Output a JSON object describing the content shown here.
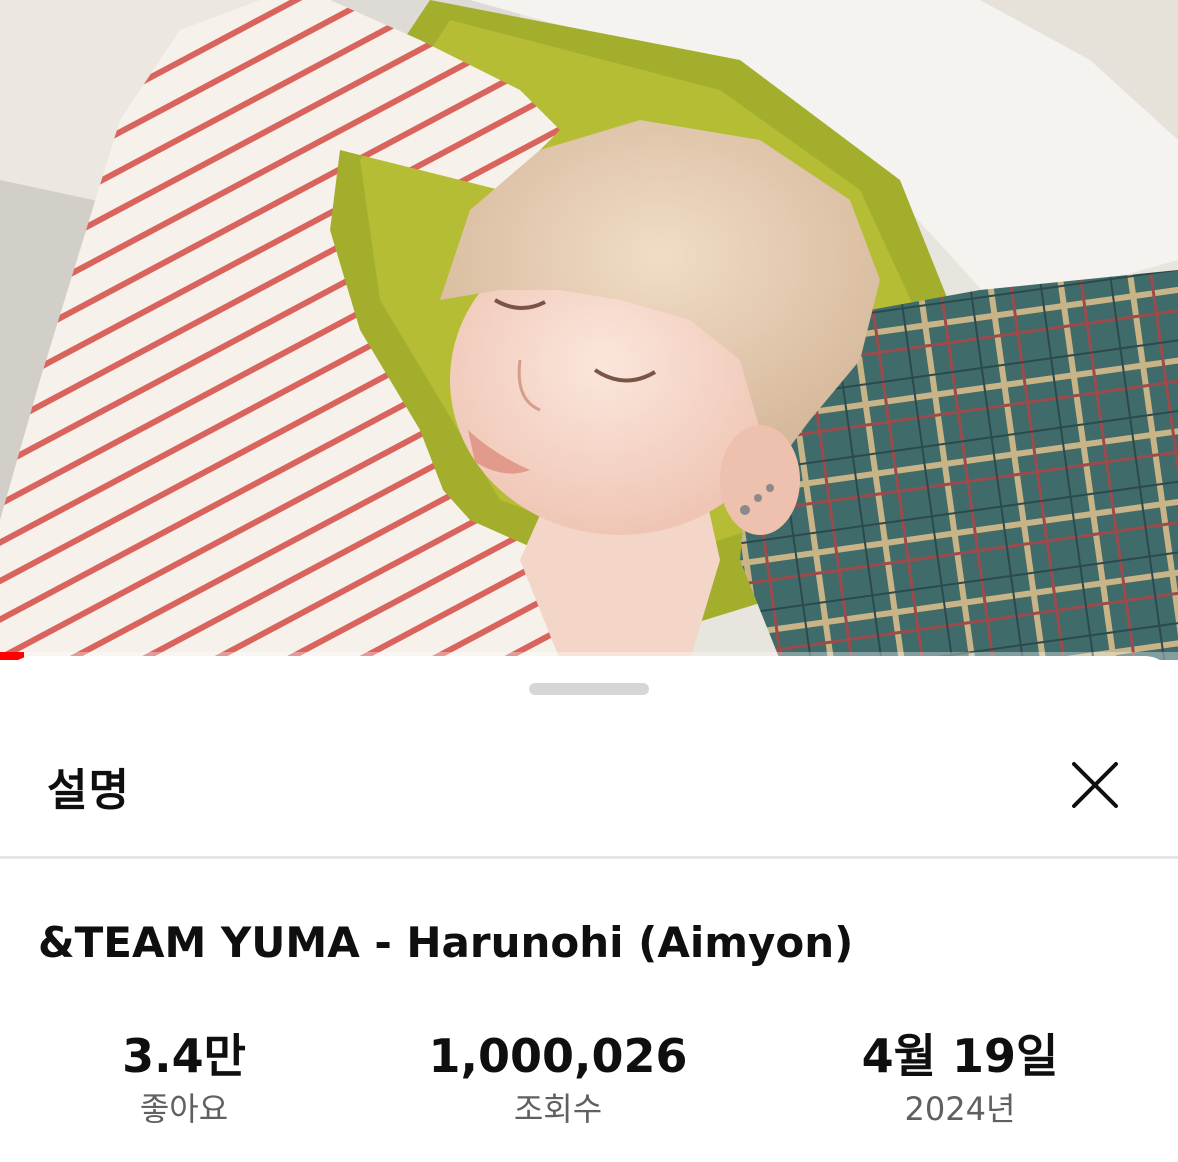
{
  "video": {
    "thumbnail_description": "",
    "progress_fraction": 0.02,
    "progress_color": "#ff0000"
  },
  "sheet": {
    "title": "설명",
    "close_icon": "close-icon"
  },
  "details": {
    "video_title": "&TEAM YUMA - Harunohi (Aimyon)",
    "stats": [
      {
        "value": "3.4만",
        "label": "좋아요"
      },
      {
        "value": "1,000,026",
        "label": "조회수"
      },
      {
        "value": "4월 19일",
        "label": "2024년"
      }
    ]
  }
}
